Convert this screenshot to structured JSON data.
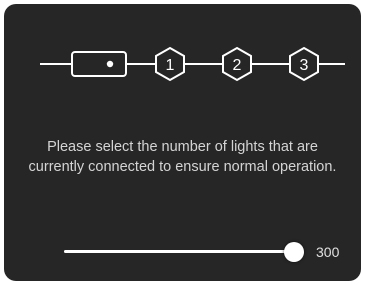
{
  "selector": {
    "steps": [
      {
        "kind": "rect",
        "label": ""
      },
      {
        "kind": "hex",
        "label": "1"
      },
      {
        "kind": "hex",
        "label": "2"
      },
      {
        "kind": "hex",
        "label": "3"
      }
    ],
    "selected_index": 0,
    "colors": {
      "stroke": "#ffffff",
      "panel": "#262626"
    }
  },
  "message": "Please select the number of lights that are currently connected to ensure normal operation.",
  "slider": {
    "value": "300",
    "fill_fraction": 1.0
  }
}
